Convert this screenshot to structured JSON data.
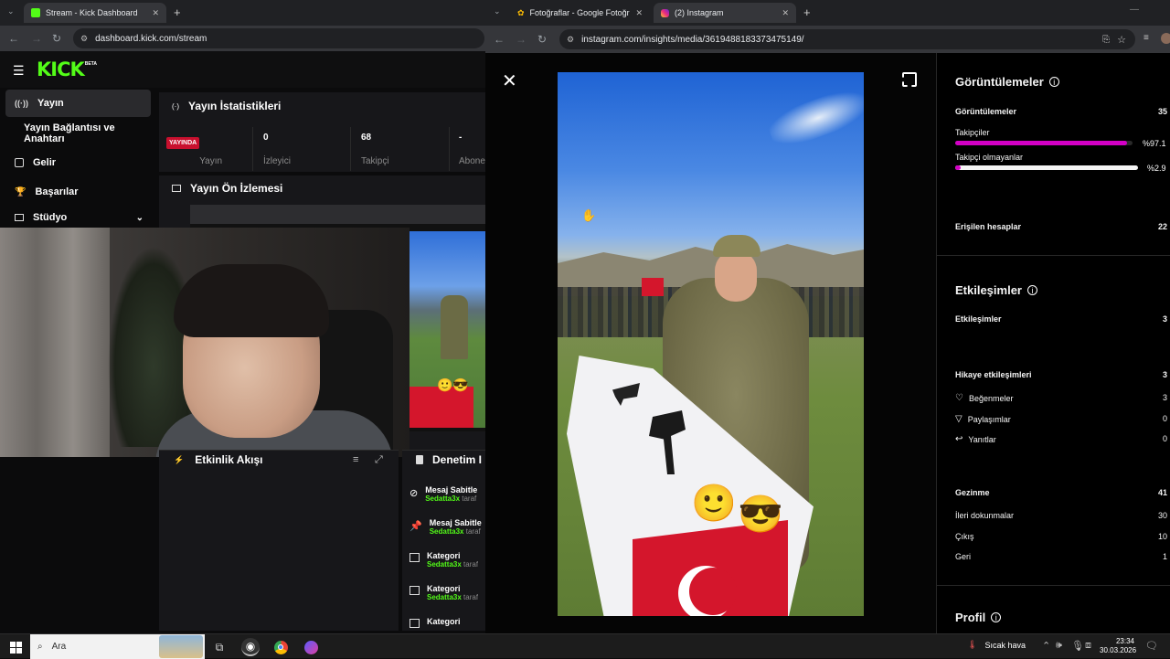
{
  "left_browser": {
    "tab_title": "Stream - Kick Dashboard",
    "url": "dashboard.kick.com/stream"
  },
  "right_browser": {
    "tab1_title": "Fotoğraflar - Google Fotoğraflar",
    "tab2_title": "(2) Instagram",
    "url": "instagram.com/insights/media/3619488183373475149/"
  },
  "kick": {
    "logo": "KICK",
    "logo_badge": "BETA",
    "sidebar": [
      {
        "label": "Yayın",
        "icon": "broadcast-icon"
      },
      {
        "label": "Yayın Bağlantısı ve Anahtarı",
        "icon": ""
      },
      {
        "label": "Gelir",
        "icon": "revenue-icon"
      },
      {
        "label": "Başarılar",
        "icon": "trophy-icon"
      },
      {
        "label": "Stüdyo",
        "icon": "studio-icon"
      }
    ],
    "stats_title": "Yayın İstatistikleri",
    "live_badge": "YAYINDA",
    "stats": [
      {
        "value": "",
        "label": "Yayın"
      },
      {
        "value": "0",
        "label": "İzleyici"
      },
      {
        "value": "68",
        "label": "Takipçi"
      },
      {
        "value": "-",
        "label": "Abone"
      }
    ],
    "preview_title": "Yayın Ön İzlemesi",
    "activity_title": "Etkinlik Akışı",
    "moderation_title": "Denetim I",
    "moderation_items": [
      {
        "title": "Mesaj Sabitle",
        "user": "Sedatta3x",
        "suffix": "taraf",
        "icon": "pin-slash-icon"
      },
      {
        "title": "Mesaj Sabitle",
        "user": "Sedatta3x",
        "suffix": "taraf",
        "icon": "pin-icon"
      },
      {
        "title": "Kategori",
        "user": "Sedatta3x",
        "suffix": "taraf",
        "icon": "category-icon"
      },
      {
        "title": "Kategori",
        "user": "Sedatta3x",
        "suffix": "taraf",
        "icon": "category-icon"
      },
      {
        "title": "Kategori",
        "user": "",
        "suffix": "",
        "icon": "category-icon"
      }
    ]
  },
  "instagram": {
    "views_title": "Görüntülemeler",
    "views_label": "Görüntülemeler",
    "views_value": "35",
    "followers_label": "Takipçiler",
    "followers_pct": "%97.1",
    "followers_fraction": 0.971,
    "nonfollowers_label": "Takipçi olmayanlar",
    "nonfollowers_pct": "%2.9",
    "nonfollowers_fraction": 0.029,
    "reached_label": "Erişilen hesaplar",
    "reached_value": "22",
    "interactions_title": "Etkileşimler",
    "interactions_label": "Etkileşimler",
    "interactions_value": "3",
    "story_interactions_label": "Hikaye etkileşimleri",
    "story_interactions_value": "3",
    "likes_label": "Beğenmeler",
    "likes_value": "3",
    "shares_label": "Paylaşımlar",
    "shares_value": "0",
    "replies_label": "Yanıtlar",
    "replies_value": "0",
    "navigation_label": "Gezinme",
    "navigation_value": "41",
    "forward_label": "İleri dokunmalar",
    "forward_value": "30",
    "exit_label": "Çıkış",
    "exit_value": "10",
    "back_label": "Geri",
    "back_value": "1",
    "profile_title": "Profil"
  },
  "taskbar": {
    "search_placeholder": "Ara",
    "weather": "Sıcak hava",
    "time": "23:34",
    "date": "30.03.2026"
  },
  "colors": {
    "kick_green": "#53fc18",
    "live_red": "#c8102e",
    "ig_magenta": "#d300c5"
  }
}
